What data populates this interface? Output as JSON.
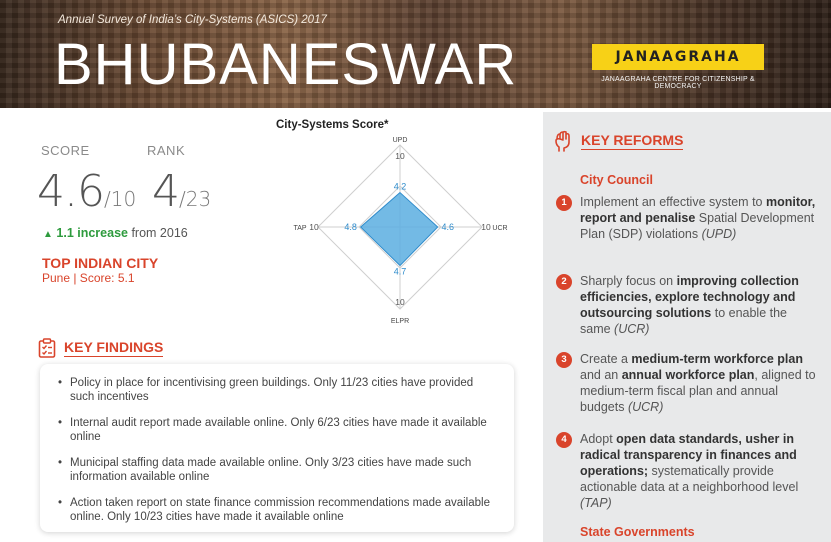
{
  "header": {
    "survey": "Annual Survey of India’s City-Systems (ASICS) 2017",
    "city": "BHUBANESWAR",
    "logo_text": "JANAAGRAHA",
    "logo_sub": "JANAAGRAHA CENTRE FOR CITIZENSHIP & DEMOCRACY"
  },
  "score": {
    "score_label": "SCORE",
    "score_value": "4.6",
    "score_max": "/10",
    "rank_label": "RANK",
    "rank_value": "4",
    "rank_total": "/23",
    "increase_arrow": "▲",
    "increase_text": "1.1 increase",
    "increase_suffix": " from 2016",
    "top_city_title": "TOP INDIAN CITY",
    "top_city_detail": "Pune | Score: 5.1"
  },
  "radar": {
    "title": "City-Systems Score*",
    "max_value": 10,
    "axes": [
      {
        "label": "UPD",
        "value": "4.2",
        "max": "10"
      },
      {
        "label": "UCR",
        "value": "4.6",
        "max": "10"
      },
      {
        "label": "ELPR",
        "value": "4.7",
        "max": "10"
      },
      {
        "label": "TAP",
        "value": "4.8",
        "max": "10"
      }
    ],
    "fill_color": "#5aaee0"
  },
  "key_findings": {
    "title": "KEY FINDINGS",
    "icon": "clipboard-checklist-icon",
    "items": [
      "Policy in place for incentivising green buildings. Only 11/23 cities have provided such incentives",
      "Internal audit report made available online. Only 6/23 cities have made it available online",
      "Municipal staffing data made available online. Only 3/23 cities have made such information available online",
      "Action taken report on state finance commission recommendations made available online. Only 10/23 cities have made it available online"
    ]
  },
  "key_reforms": {
    "title": "KEY REFORMS",
    "icon": "raised-fist-icon",
    "section1": "City Council",
    "section2": "State Governments",
    "items": [
      {
        "num": "1",
        "parts": [
          {
            "t": "Implement an effective system to ",
            "s": "n"
          },
          {
            "t": "monitor, report and penalise",
            "s": "b"
          },
          {
            "t": " Spatial Development Plan (SDP) violations ",
            "s": "n"
          },
          {
            "t": "(UPD)",
            "s": "i"
          }
        ]
      },
      {
        "num": "2",
        "parts": [
          {
            "t": "Sharply focus on ",
            "s": "n"
          },
          {
            "t": "improving collection efficiencies, explore technology and outsourcing solutions",
            "s": "b"
          },
          {
            "t": " to enable the same ",
            "s": "n"
          },
          {
            "t": "(UCR)",
            "s": "i"
          }
        ]
      },
      {
        "num": "3",
        "parts": [
          {
            "t": "Create a ",
            "s": "n"
          },
          {
            "t": "medium-term workforce plan",
            "s": "b"
          },
          {
            "t": " and an ",
            "s": "n"
          },
          {
            "t": "annual workforce plan",
            "s": "b"
          },
          {
            "t": ", aligned to medium-term fiscal plan and annual budgets ",
            "s": "n"
          },
          {
            "t": "(UCR)",
            "s": "i"
          }
        ]
      },
      {
        "num": "4",
        "parts": [
          {
            "t": "Adopt ",
            "s": "n"
          },
          {
            "t": "open data standards, usher in radical transparency in finances and operations;",
            "s": "b"
          },
          {
            "t": " systematically provide actionable data at a neighborhood level ",
            "s": "n"
          },
          {
            "t": "(TAP)",
            "s": "i"
          }
        ]
      }
    ]
  },
  "colors": {
    "accent": "#d9442b",
    "increase_green": "#2e9b3e",
    "right_panel": "#e8e9ea"
  }
}
